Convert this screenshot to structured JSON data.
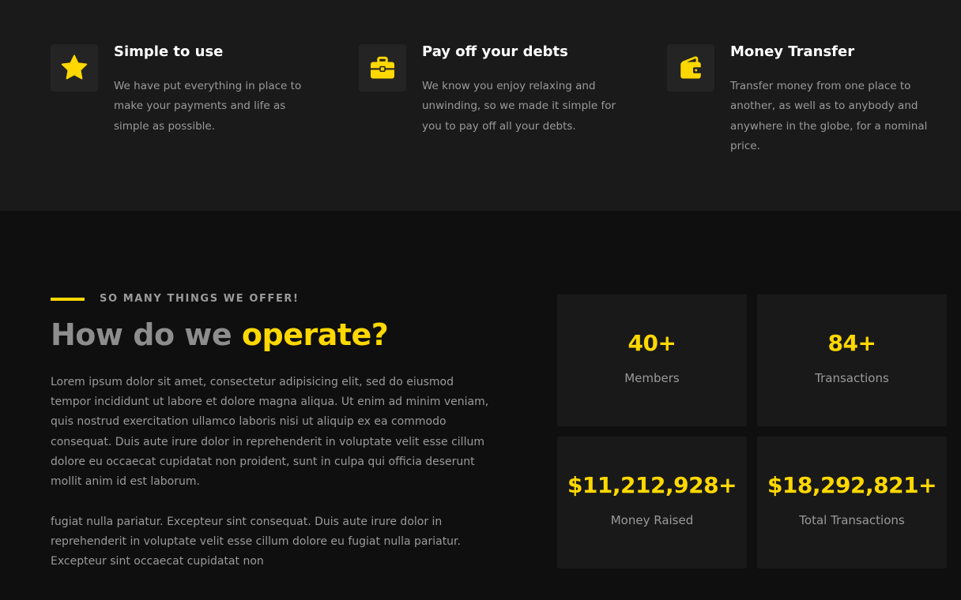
{
  "features": [
    {
      "icon": "star-icon",
      "title": "Simple to use",
      "description": "We have put everything in place to make your payments and life as simple as possible."
    },
    {
      "icon": "briefcase-icon",
      "title": "Pay off your debts",
      "description": "We know you enjoy relaxing and unwinding, so we made it simple for you to pay off all your debts."
    },
    {
      "icon": "wallet-icon",
      "title": "Money Transfer",
      "description": "Transfer money from one place to another, as well as to anybody and anywhere in the globe, for a nominal price."
    }
  ],
  "operate": {
    "eyebrow": "SO MANY THINGS WE OFFER!",
    "headline_part1": "How do we ",
    "headline_part2": "operate?",
    "paragraph1": "Lorem ipsum dolor sit amet, consectetur adipisicing elit, sed do eiusmod tempor incididunt ut labore et dolore magna aliqua. Ut enim ad minim veniam, quis nostrud exercitation ullamco laboris nisi ut aliquip ex ea commodo consequat. Duis aute irure dolor in reprehenderit in voluptate velit esse cillum dolore eu occaecat cupidatat non proident, sunt in culpa qui officia deserunt mollit anim id est laborum.",
    "paragraph2": "fugiat nulla pariatur. Excepteur sint consequat. Duis aute irure dolor in reprehenderit in voluptate velit esse cillum dolore eu fugiat nulla pariatur. Excepteur sint occaecat cupidatat non"
  },
  "stats": [
    {
      "value": "40+",
      "label": "Members"
    },
    {
      "value": "84+",
      "label": "Transactions"
    },
    {
      "value": "$11,212,928+",
      "label": "Money Raised"
    },
    {
      "value": "$18,292,821+",
      "label": "Total Transactions"
    }
  ],
  "colors": {
    "accent": "#ffd800",
    "feature_bg": "#1a1a1a",
    "page_bg": "#0f0f0f",
    "card_bg": "#191919"
  }
}
